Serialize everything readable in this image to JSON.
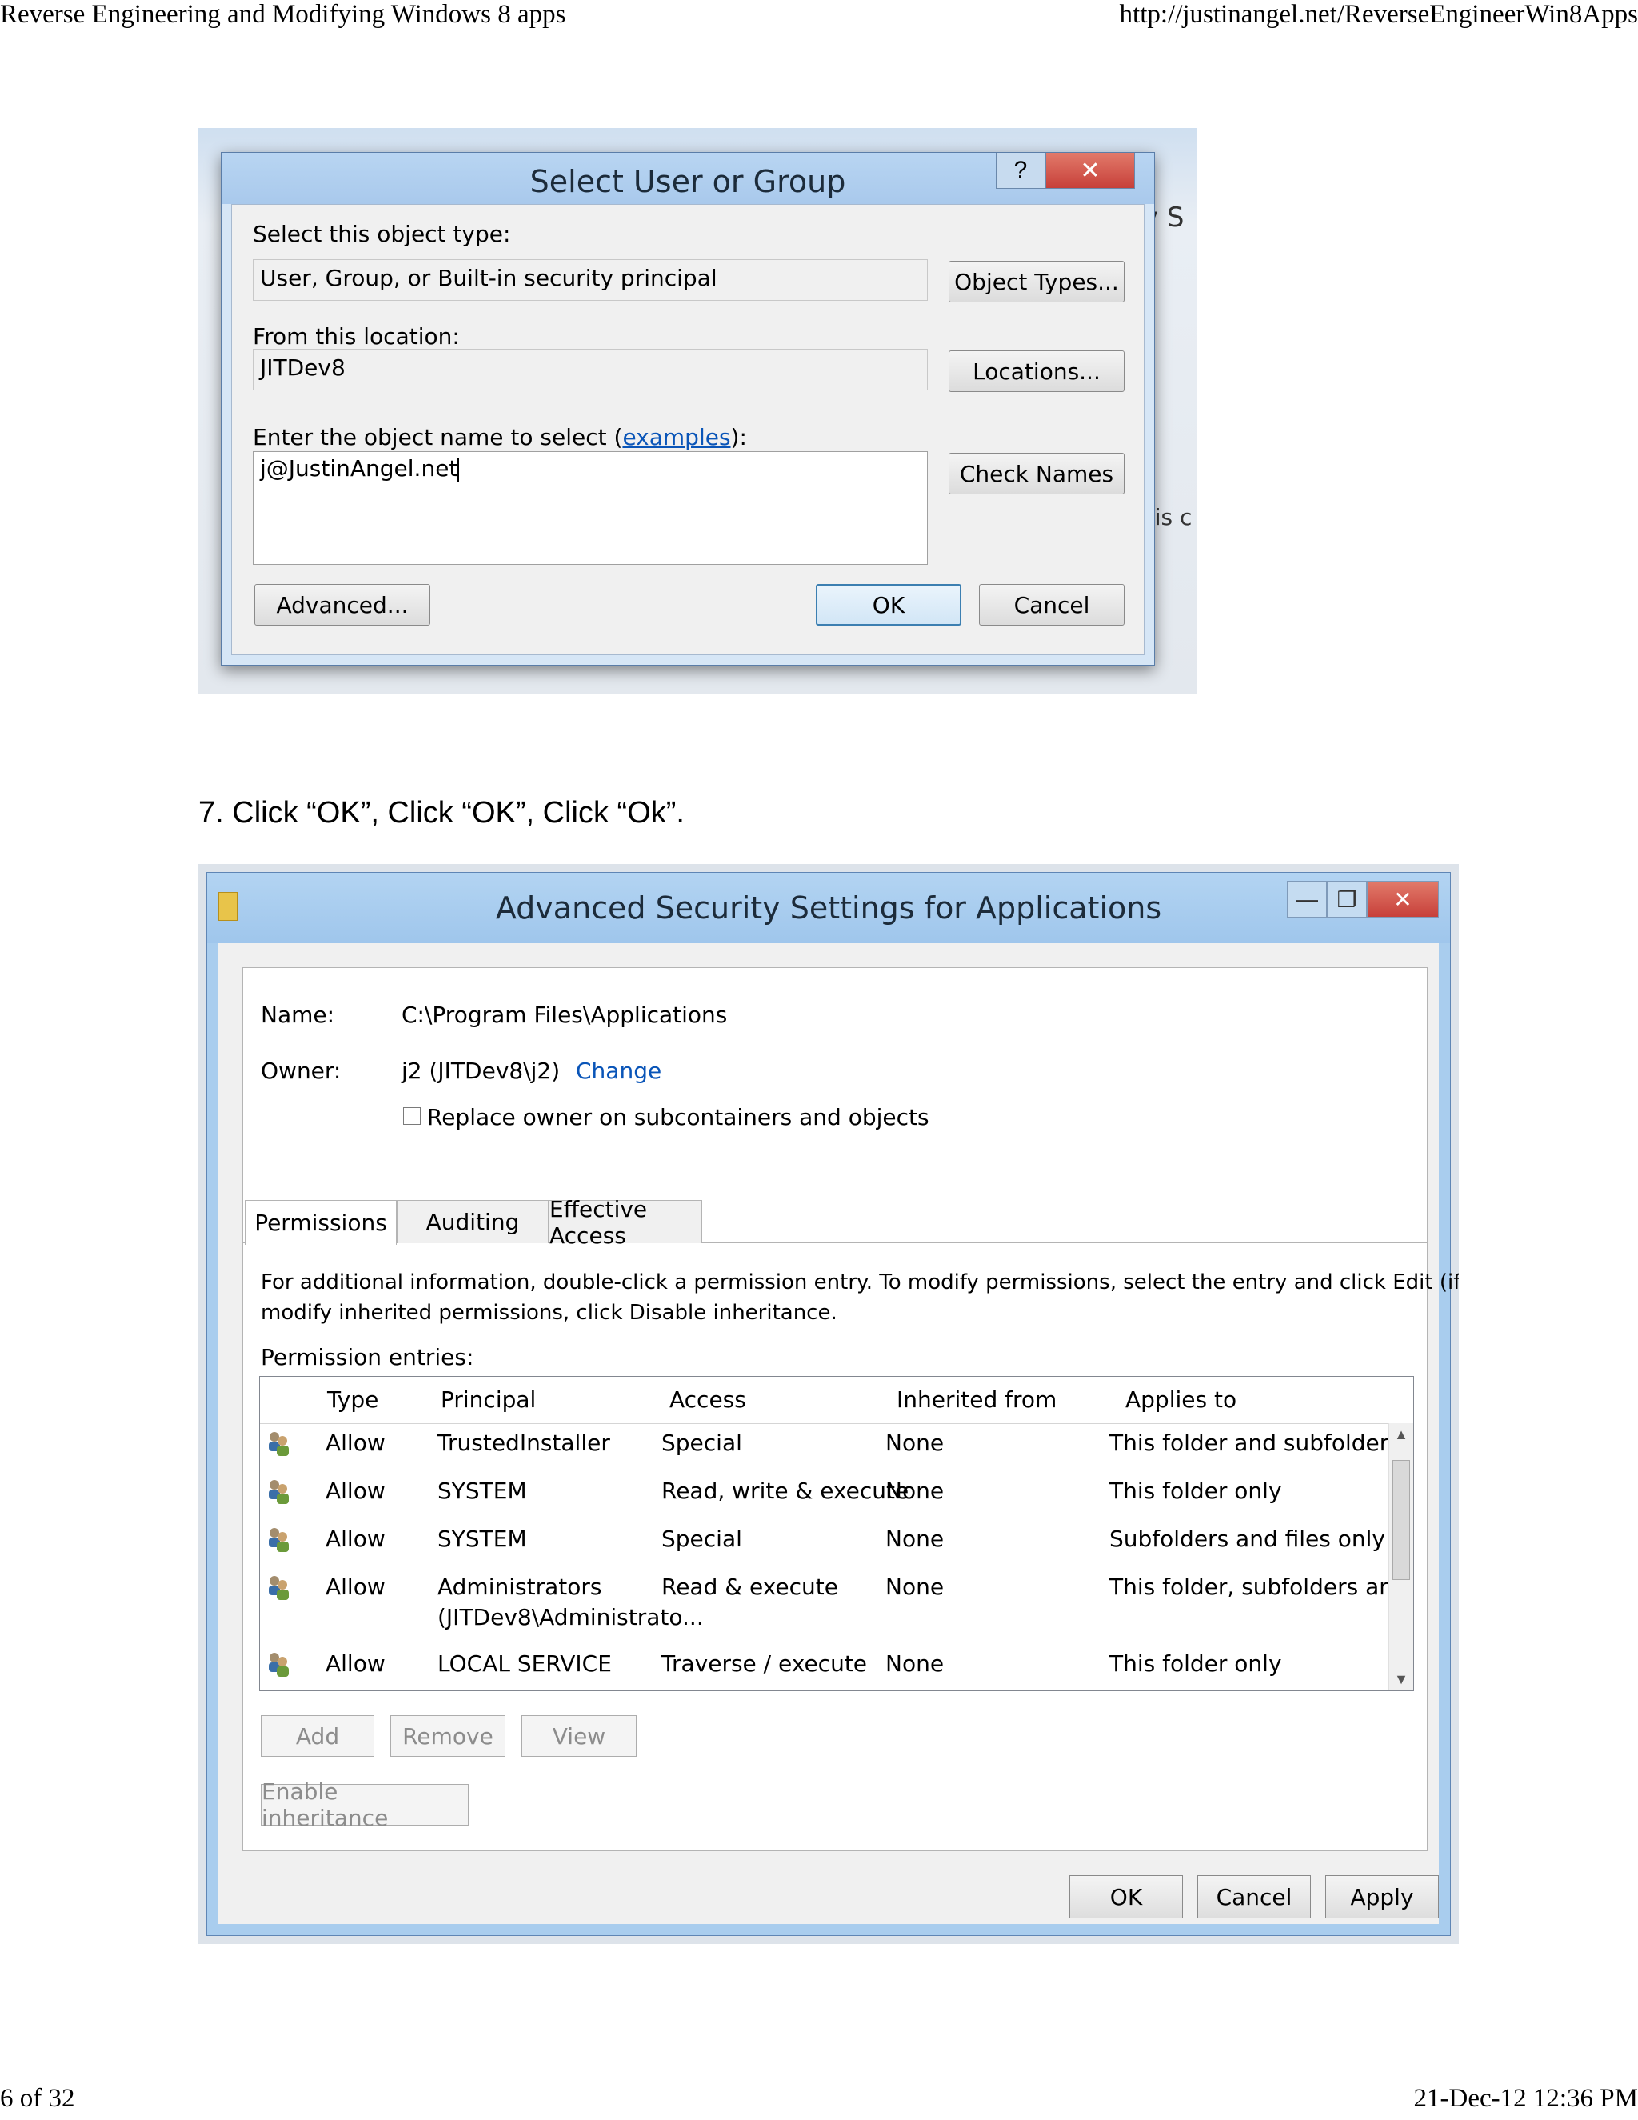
{
  "print_header": {
    "left": "Reverse Engineering and Modifying Windows 8 apps",
    "right": "http://justinangel.net/ReverseEngineerWin8Apps"
  },
  "print_footer": {
    "left": "6 of 32",
    "right": "21-Dec-12 12:36 PM"
  },
  "select_user_dialog": {
    "title": "Select User or Group",
    "help_glyph": "?",
    "close_glyph": "✕",
    "object_type_label": "Select this object type:",
    "object_type_value": "User, Group, or Built-in security principal",
    "object_types_button": "Object Types...",
    "location_label": "From this location:",
    "location_value": "JITDev8",
    "locations_button": "Locations...",
    "object_name_label_prefix": "Enter the object name to select (",
    "object_name_label_link": "examples",
    "object_name_label_suffix": "):",
    "object_name_value": "j@JustinAngel.net",
    "check_names_button": "Check Names",
    "advanced_button": "Advanced...",
    "ok_button": "OK",
    "cancel_button": "Cancel"
  },
  "background_fragments": {
    "right_top": "y S",
    "right_mid": "his c"
  },
  "caption": "7. Click “OK”, Click “OK”, Click “Ok”.",
  "advanced_security_dialog": {
    "title": "Advanced Security Settings for Applications",
    "minimize_glyph": "—",
    "restore_glyph": "❐",
    "close_glyph": "✕",
    "name_label": "Name:",
    "name_value": "C:\\Program Files\\Applications",
    "owner_label": "Owner:",
    "owner_value": "j2 (JITDev8\\j2)",
    "owner_change_link": "Change",
    "replace_owner_checkbox": "Replace owner on subcontainers and objects",
    "replace_owner_checked": false,
    "tabs": [
      {
        "label": "Permissions"
      },
      {
        "label": "Auditing"
      },
      {
        "label": "Effective Access"
      }
    ],
    "info_line1": "For additional information, double-click a permission entry. To modify permissions, select the entry and click Edit (if available). To",
    "info_line2": "modify inherited permissions, click Disable inheritance.",
    "entries_label": "Permission entries:",
    "columns": [
      "Type",
      "Principal",
      "Access",
      "Inherited from",
      "Applies to"
    ],
    "rows": [
      {
        "type": "Allow",
        "principal": "TrustedInstaller",
        "principal2": "",
        "access": "Special",
        "inherited": "None",
        "applies": "This folder and subfolders"
      },
      {
        "type": "Allow",
        "principal": "SYSTEM",
        "principal2": "",
        "access": "Read, write & execute",
        "inherited": "None",
        "applies": "This folder only"
      },
      {
        "type": "Allow",
        "principal": "SYSTEM",
        "principal2": "",
        "access": "Special",
        "inherited": "None",
        "applies": "Subfolders and files only"
      },
      {
        "type": "Allow",
        "principal": "Administrators",
        "principal2": "(JITDev8\\Administrato...",
        "access": "Read & execute",
        "inherited": "None",
        "applies": "This folder, subfolders and files"
      },
      {
        "type": "Allow",
        "principal": "LOCAL SERVICE",
        "principal2": "",
        "access": "Traverse / execute",
        "inherited": "None",
        "applies": "This folder only"
      }
    ],
    "add_button": "Add",
    "remove_button": "Remove",
    "view_button": "View",
    "enable_inheritance_button": "Enable inheritance",
    "ok_button": "OK",
    "cancel_button": "Cancel",
    "apply_button": "Apply"
  },
  "colors": {
    "title_bar": "#a9cdee",
    "close_button": "#c7403a",
    "link": "#0a55b8"
  }
}
